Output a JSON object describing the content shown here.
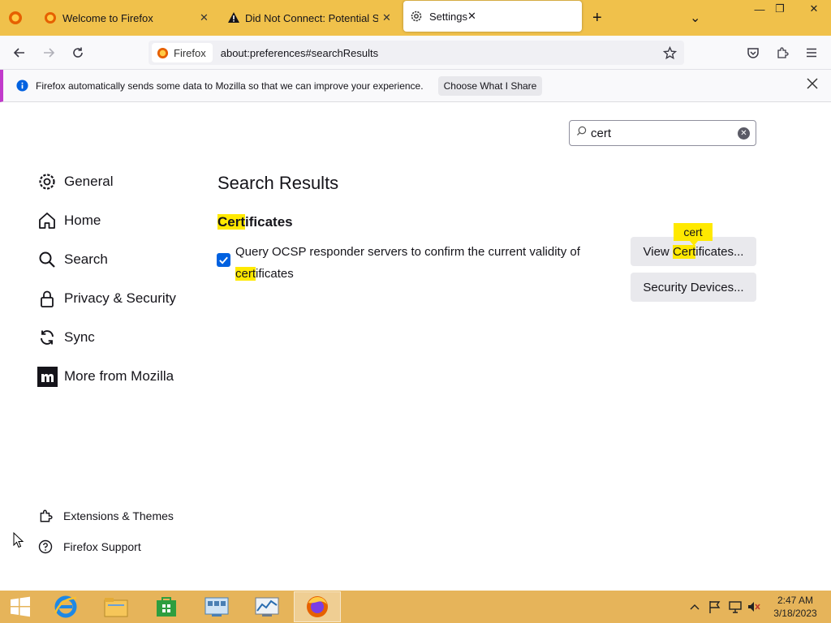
{
  "browser": {
    "tabs": [
      {
        "title": "Welcome to Firefox",
        "close": "✕"
      },
      {
        "title": "Did Not Connect: Potential Security Issue",
        "close": "✕"
      },
      {
        "title": "Settings",
        "close": "✕"
      }
    ],
    "new_tab": "+",
    "list_tabs": "⌄",
    "window_controls": {
      "minimize": "—",
      "restore": "❐",
      "close": "✕"
    }
  },
  "toolbar": {
    "identity_label": "Firefox",
    "url": "about:preferences#searchResults"
  },
  "notification": {
    "message": "Firefox automatically sends some data to Mozilla so that we can improve your experience.",
    "button": "Choose What I Share"
  },
  "search": {
    "value": "cert"
  },
  "sidebar": {
    "items": [
      {
        "label": "General",
        "icon": "gear-icon"
      },
      {
        "label": "Home",
        "icon": "home-icon"
      },
      {
        "label": "Search",
        "icon": "search-icon"
      },
      {
        "label": "Privacy & Security",
        "icon": "lock-icon"
      },
      {
        "label": "Sync",
        "icon": "sync-icon"
      },
      {
        "label": "More from Mozilla",
        "icon": "mozilla-icon"
      }
    ],
    "footer": [
      {
        "label": "Extensions & Themes",
        "icon": "puzzle-icon"
      },
      {
        "label": "Firefox Support",
        "icon": "help-icon"
      }
    ]
  },
  "main": {
    "heading": "Search Results",
    "section": {
      "title_hl": "Cert",
      "title_rest": "ificates"
    },
    "checkbox": {
      "checked": true,
      "label_part1": "Query OCSP responder servers to confirm the current validity of",
      "label_hl": "cert",
      "label_part2": "ificates"
    },
    "buttons": {
      "view_prefix": "View ",
      "view_hl": "Cert",
      "view_suffix": "ificates...",
      "devices": "Security Devices..."
    },
    "tooltip": "cert"
  },
  "taskbar": {
    "clock_time": "2:47 AM",
    "clock_date": "3/18/2023"
  },
  "colors": {
    "tabbar": "#f0c14b",
    "accent": "#0061e0",
    "highlight": "#ffe900",
    "notification_border": "#c13acb",
    "taskbar": "#e6b45a"
  }
}
